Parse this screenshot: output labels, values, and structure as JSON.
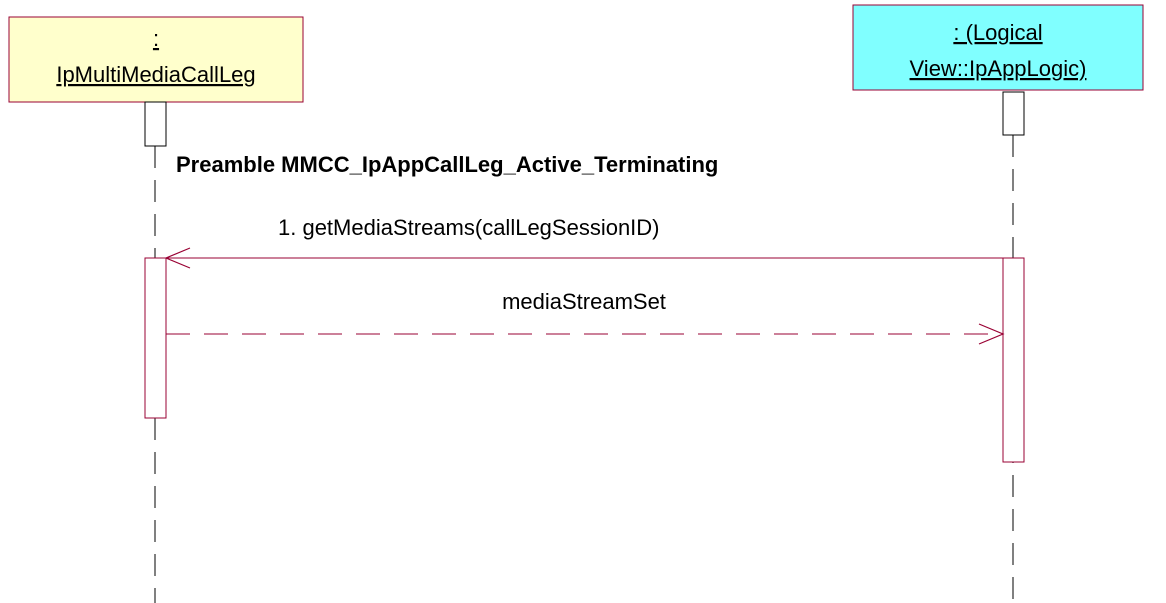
{
  "diagram": {
    "type": "sequence",
    "title": "Preamble MMCC_IpAppCallLeg_Active_Terminating",
    "colors": {
      "object_left_fill": "#ffffcc",
      "object_left_stroke": "#990033",
      "object_right_fill": "#80ffff",
      "object_right_stroke": "#990033",
      "activation_stroke": "#990033",
      "message_stroke": "#990033",
      "lifeline_stroke": "#000000"
    },
    "objects": [
      {
        "id": "caller",
        "line1": ":",
        "line2": "IpMultiMediaCallLeg"
      },
      {
        "id": "app",
        "line1": ": (Logical",
        "line2": "View::IpAppLogic)"
      }
    ],
    "messages": [
      {
        "label": "1. getMediaStreams(callLegSessionID)",
        "from": "app",
        "to": "caller",
        "style": "solid"
      },
      {
        "label": "mediaStreamSet",
        "from": "caller",
        "to": "app",
        "style": "dashed"
      }
    ]
  }
}
